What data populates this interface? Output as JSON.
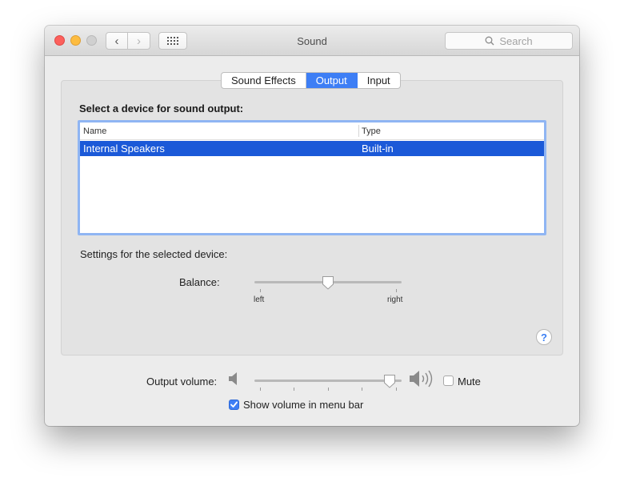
{
  "window": {
    "title": "Sound"
  },
  "toolbar": {
    "search_placeholder": "Search"
  },
  "tabs": [
    {
      "label": "Sound Effects",
      "active": false
    },
    {
      "label": "Output",
      "active": true
    },
    {
      "label": "Input",
      "active": false
    }
  ],
  "output": {
    "heading": "Select a device for sound output:",
    "columns": {
      "name": "Name",
      "type": "Type"
    },
    "devices": [
      {
        "name": "Internal Speakers",
        "type": "Built-in",
        "selected": true
      }
    ],
    "settings_label": "Settings for the selected device:",
    "balance": {
      "label": "Balance:",
      "left": "left",
      "right": "right",
      "value": 0.5
    }
  },
  "volume": {
    "label": "Output volume:",
    "value": 0.92,
    "mute_label": "Mute",
    "mute_checked": false
  },
  "menubar": {
    "show_label": "Show volume in menu bar",
    "checked": true
  },
  "help": {
    "label": "?"
  },
  "colors": {
    "accent": "#3d7ef5",
    "selection": "#1b59d8"
  }
}
